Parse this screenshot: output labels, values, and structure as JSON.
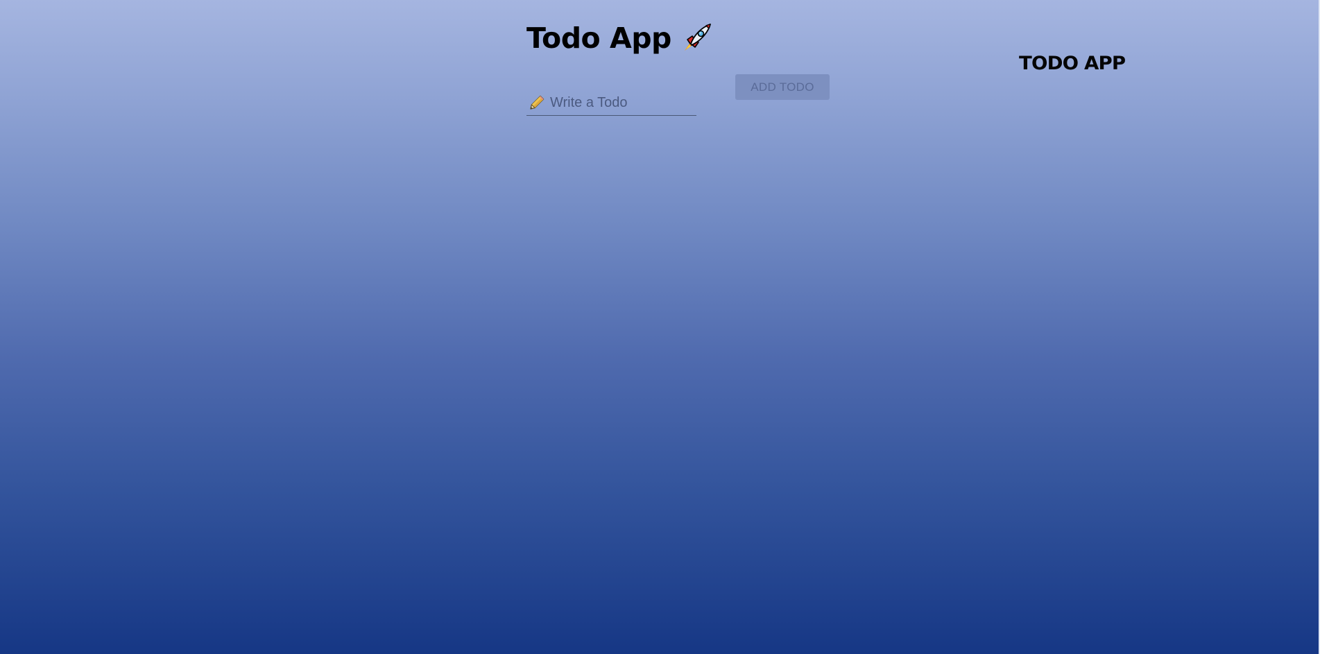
{
  "header": {
    "title": "Todo App",
    "title_icon": "rocket-icon"
  },
  "form": {
    "input_icon": "pencil-icon",
    "input_placeholder": "Write a Todo",
    "input_value": "",
    "add_button_label": "ADD TODO"
  },
  "logo": {
    "text": "TODO APP"
  },
  "colors": {
    "background_top": "#a5b5e0",
    "background_bottom": "#163785",
    "button_bg": "#7d90c0",
    "button_text": "#5a6b98"
  }
}
